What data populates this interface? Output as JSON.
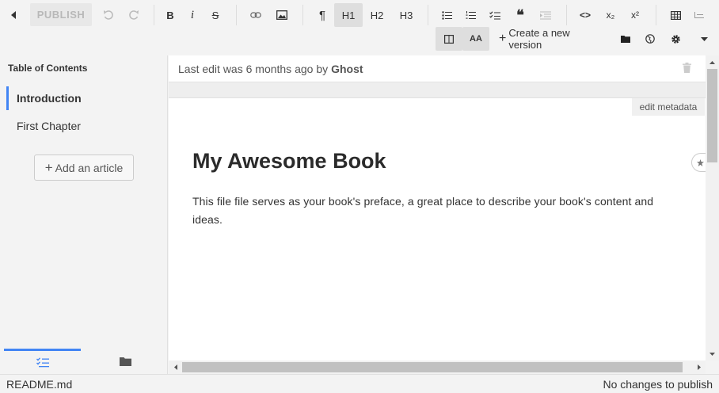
{
  "toolbar": {
    "publish_label": "PUBLISH",
    "h1_label": "H1",
    "h2_label": "H2",
    "h3_label": "H3",
    "bold_label": "B",
    "italic_label": "i",
    "strike_label": "S",
    "paragraph_label": "¶",
    "subscript_label": "x₂",
    "superscript_label": "x²",
    "code_label": "<>",
    "quote_label": "❝",
    "font_size_label": "AA",
    "create_version_label": "Create a new version",
    "plus_symbol": "+"
  },
  "sidebar": {
    "title": "Table of Contents",
    "items": [
      {
        "label": "Introduction",
        "selected": true
      },
      {
        "label": "First Chapter",
        "selected": false
      }
    ],
    "add_article_label": "Add an article",
    "add_plus": "+",
    "tabs": [
      {
        "icon": "checklist-icon",
        "active": true
      },
      {
        "icon": "folder-icon",
        "active": false
      }
    ]
  },
  "editor": {
    "last_edit_prefix": "Last edit was 6 months ago by",
    "last_edit_author": "Ghost",
    "metadata_label": "edit metadata",
    "doc_title": "My Awesome Book",
    "doc_body": "This file file serves as your book's preface, a great place to describe your book's content and ideas."
  },
  "status": {
    "filename": "README.md",
    "publish_state": "No changes to publish"
  },
  "colors": {
    "accent": "#4285f4",
    "toolbar_bg": "#f3f3f3",
    "editor_bg": "#ffffff"
  }
}
